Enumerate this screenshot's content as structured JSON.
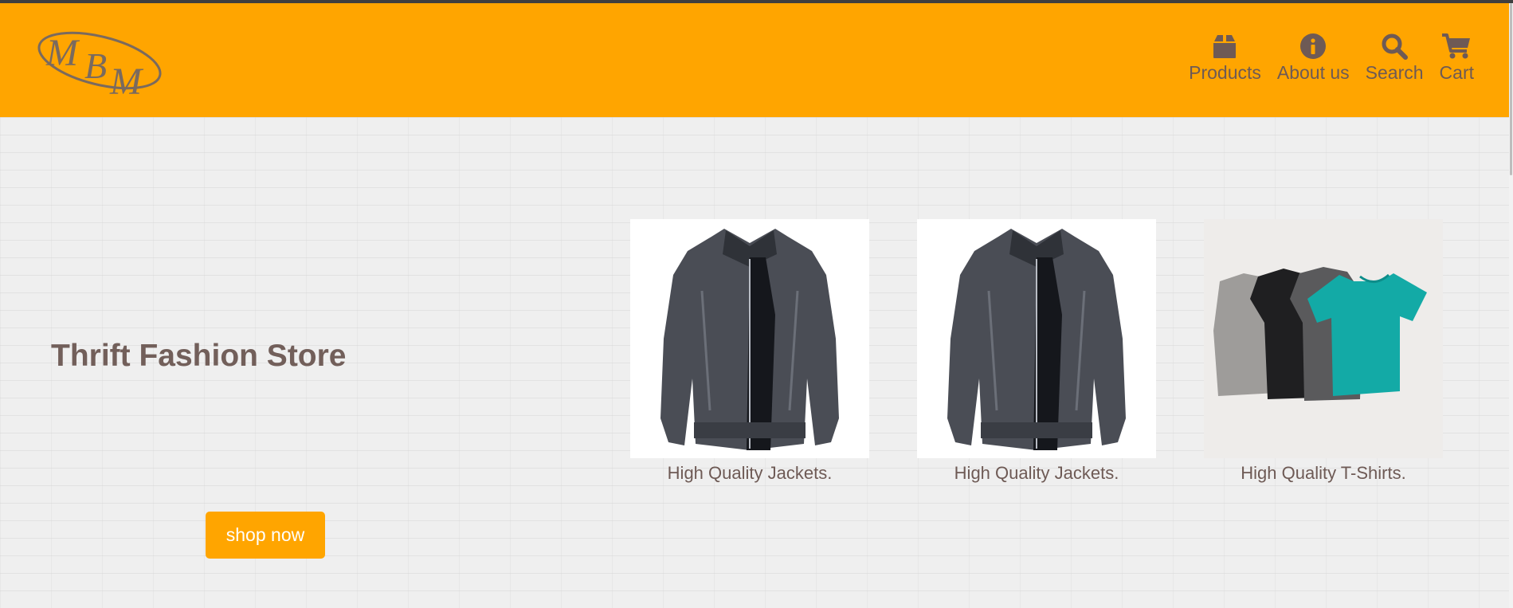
{
  "header": {
    "logo_text": "MBM",
    "nav": [
      {
        "label": "Products",
        "icon": "box-icon"
      },
      {
        "label": "About us",
        "icon": "info-icon"
      },
      {
        "label": "Search",
        "icon": "search-icon"
      },
      {
        "label": "Cart",
        "icon": "cart-icon"
      }
    ]
  },
  "hero": {
    "title": "Thrift Fashion Store",
    "cta_label": "shop now"
  },
  "products": [
    {
      "caption": "High Quality Jackets.",
      "image": "denim-jacket-image"
    },
    {
      "caption": "High Quality Jackets.",
      "image": "denim-jacket-image"
    },
    {
      "caption": "High Quality T-Shirts.",
      "image": "tshirts-image"
    }
  ],
  "colors": {
    "brand": "#ffa500",
    "text": "#725f5a",
    "background": "#efefef"
  }
}
